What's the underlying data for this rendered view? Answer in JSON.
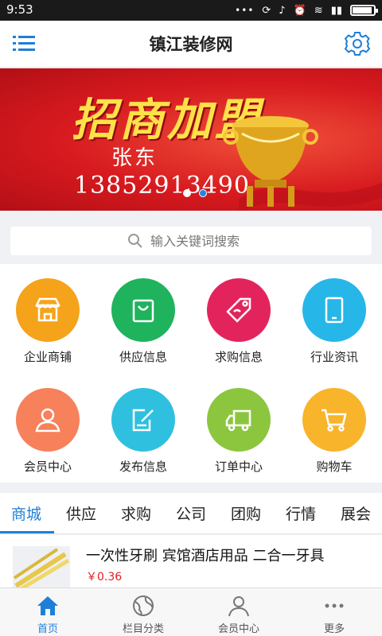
{
  "status_bar": {
    "time": "9:53"
  },
  "header": {
    "title": "镇江装修网"
  },
  "banner": {
    "slogan": "招商加盟",
    "contact_name": "张东",
    "phone": "13852913490",
    "slides": 2,
    "active_slide": 2
  },
  "search": {
    "placeholder": "输入关键词搜索"
  },
  "grid": [
    {
      "label": "企业商铺",
      "icon": "store-icon",
      "color": "#f5a31a"
    },
    {
      "label": "供应信息",
      "icon": "shopping-bag-icon",
      "color": "#1fb35d"
    },
    {
      "label": "求购信息",
      "icon": "price-tag-icon",
      "color": "#e3245c"
    },
    {
      "label": "行业资讯",
      "icon": "tablet-icon",
      "color": "#27b6e8"
    },
    {
      "label": "会员中心",
      "icon": "user-icon",
      "color": "#f6815a"
    },
    {
      "label": "发布信息",
      "icon": "edit-icon",
      "color": "#2fc0e0"
    },
    {
      "label": "订单中心",
      "icon": "truck-icon",
      "color": "#8cc63f"
    },
    {
      "label": "购物车",
      "icon": "cart-icon",
      "color": "#f8b42a"
    }
  ],
  "tabs": [
    "商城",
    "供应",
    "求购",
    "公司",
    "团购",
    "行情",
    "展会"
  ],
  "active_tab": 0,
  "product": {
    "title": "一次性牙刷 宾馆酒店用品 二合一牙具",
    "price": "￥0.36"
  },
  "bottom_nav": [
    {
      "label": "首页",
      "icon": "home-icon"
    },
    {
      "label": "栏目分类",
      "icon": "category-icon"
    },
    {
      "label": "会员中心",
      "icon": "member-icon"
    },
    {
      "label": "更多",
      "icon": "more-icon"
    }
  ],
  "active_bottom": 0,
  "colors": {
    "accent": "#1e7fd8",
    "price": "#e02020"
  }
}
